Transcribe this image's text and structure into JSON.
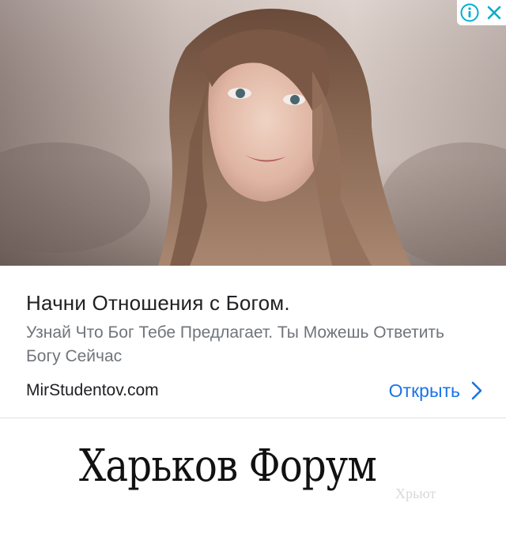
{
  "ad": {
    "image": {
      "subject": "portrait-photo"
    },
    "adchoices": {
      "info_icon": "info-icon",
      "close_icon": "close-icon",
      "accent": "#00aecd"
    },
    "headline": "Начни Отношения с Богом.",
    "description": "Узнай Что Бог Тебе Предлагает. Ты Можешь Ответить Богу Сейчас",
    "domain": "MirStudentov.com",
    "cta": {
      "label": "Открыть",
      "icon": "chevron-right-icon",
      "color": "#1a73e8"
    }
  },
  "site": {
    "logo_text": "Харьков Форум",
    "logo_ghost": "Xpьют"
  }
}
